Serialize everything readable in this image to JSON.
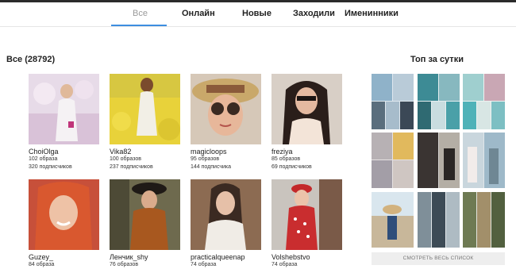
{
  "tabs": [
    {
      "label": "Все"
    },
    {
      "label": "Онлайн"
    },
    {
      "label": "Новые"
    },
    {
      "label": "Заходили"
    },
    {
      "label": "Именинники"
    }
  ],
  "main": {
    "title": "Все (28792)",
    "users": [
      {
        "name": "ChoiOlga",
        "looks": "102 образа",
        "followers": "320 подписчиков"
      },
      {
        "name": "Vika82",
        "looks": "100 образов",
        "followers": "237 подписчиков"
      },
      {
        "name": "magicloops",
        "looks": "95 образов",
        "followers": "144 подписчика"
      },
      {
        "name": "freziya",
        "looks": "85 образов",
        "followers": "69 подписчиков"
      },
      {
        "name": "Guzey_",
        "looks": "84 образа",
        "followers": ""
      },
      {
        "name": "Ленчик_shy",
        "looks": "76 образов",
        "followers": ""
      },
      {
        "name": "practicalqueenap",
        "looks": "74 образа",
        "followers": ""
      },
      {
        "name": "Volshebstvo",
        "looks": "74 образа",
        "followers": ""
      }
    ]
  },
  "sidebar": {
    "title": "Топ за сутки",
    "see_all": "СМОТРЕТЬ ВЕСЬ СПИСОК"
  },
  "colors": {
    "accent": "#3d8ee0",
    "topbar": "#2b2b2b"
  }
}
